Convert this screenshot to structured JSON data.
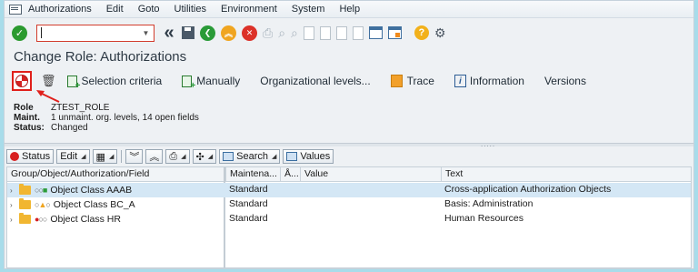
{
  "menu": {
    "items": [
      "Authorizations",
      "Edit",
      "Goto",
      "Utilities",
      "Environment",
      "System",
      "Help"
    ]
  },
  "toolbar": {
    "command_value": "",
    "icons": [
      "check-icon",
      "command-field",
      "back-icon",
      "save-icon",
      "green-back-icon",
      "exit-icon",
      "cancel-icon",
      "print-icon",
      "find-icon",
      "find-next-icon",
      "first-page-icon",
      "prev-page-icon",
      "next-page-icon",
      "last-page-icon",
      "new-session-icon",
      "shortcut-icon",
      "help-icon",
      "settings-icon"
    ]
  },
  "page": {
    "title": "Change Role: Authorizations"
  },
  "app_toolbar": {
    "selection_criteria": "Selection criteria",
    "manually": "Manually",
    "org_levels": "Organizational levels...",
    "trace": "Trace",
    "information": "Information",
    "versions": "Versions"
  },
  "role_info": {
    "role_label": "Role",
    "role_value": "ZTEST_ROLE",
    "maint_label": "Maint.",
    "maint_value": "1 unmaint. org. levels, 14 open fields",
    "status_label": "Status:",
    "status_value": "Changed"
  },
  "alv_toolbar": {
    "status": "Status",
    "edit": "Edit",
    "search": "Search",
    "values": "Values"
  },
  "grid": {
    "columns": [
      "Group/Object/Authorization/Field",
      "Maintena...",
      "Å...",
      "Value",
      "Text"
    ],
    "rows": [
      {
        "name": "Object Class AAAB",
        "maintenance": "Standard",
        "value": "",
        "text": "Cross-application Authorization Objects",
        "lights": "green"
      },
      {
        "name": "Object Class BC_A",
        "maintenance": "Standard",
        "value": "",
        "text": "Basis: Administration",
        "lights": "yellow"
      },
      {
        "name": "Object Class HR",
        "maintenance": "Standard",
        "value": "",
        "text": "Human Resources",
        "lights": "red"
      }
    ]
  },
  "colors": {
    "highlight_border": "#e0201b",
    "selected_row": "#d4e7f5",
    "background": "#eef1f4"
  }
}
